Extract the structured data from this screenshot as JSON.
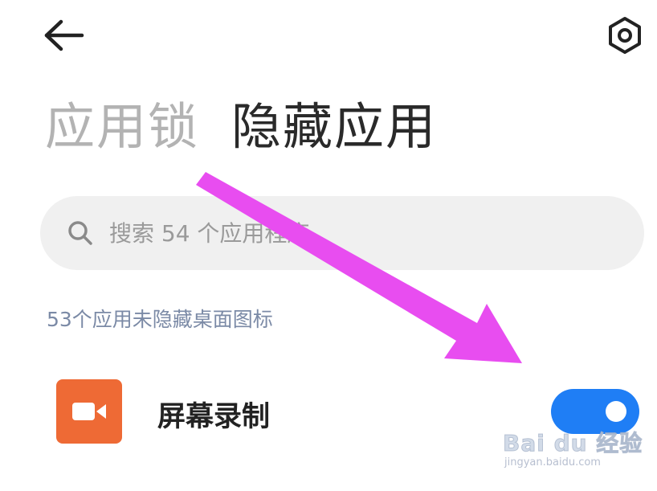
{
  "header": {
    "back_icon": "arrow-left-icon",
    "settings_icon": "hexagon-gear-icon"
  },
  "tabs": [
    {
      "label": "应用锁",
      "active": false
    },
    {
      "label": "隐藏应用",
      "active": true
    }
  ],
  "search": {
    "placeholder": "搜索 54 个应用程序",
    "value": "",
    "icon": "search-icon"
  },
  "section": {
    "label": "53个应用未隐藏桌面图标"
  },
  "apps": [
    {
      "name": "屏幕录制",
      "icon": "video-camera-icon",
      "icon_color": "#ee6a35",
      "toggle_on": true
    }
  ],
  "colors": {
    "accent": "#1f7ef5",
    "annotation_arrow": "#e84df0"
  },
  "watermark": {
    "logo": "Bai du 经验",
    "url": "jingyan.baidu.com"
  }
}
